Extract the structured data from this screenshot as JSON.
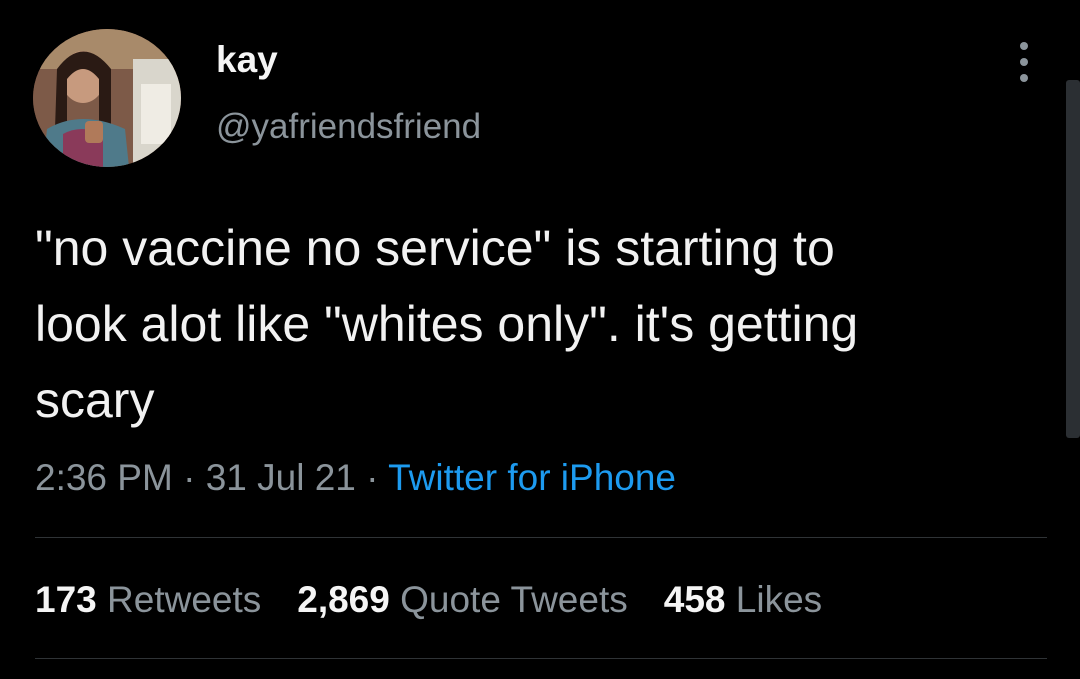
{
  "user": {
    "display_name": "kay",
    "handle": "@yafriendsfriend",
    "avatar_icon": "profile-photo"
  },
  "tweet": {
    "text": "\"no vaccine no service\" is starting to\nlook alot like \"whites only\". it's getting\nscary",
    "time": "2:36 PM",
    "date": "31 Jul 21",
    "separator": "·",
    "source": "Twitter for iPhone"
  },
  "stats": {
    "retweets_count": "173",
    "retweets_label": "Retweets",
    "quotes_count": "2,869",
    "quotes_label": "Quote Tweets",
    "likes_count": "458",
    "likes_label": "Likes"
  },
  "colors": {
    "background": "#000000",
    "link": "#1d9bf0",
    "secondary_text": "#8b949b",
    "primary_text": "#f2f2f2"
  },
  "icons": {
    "more": "more-vertical-icon"
  }
}
